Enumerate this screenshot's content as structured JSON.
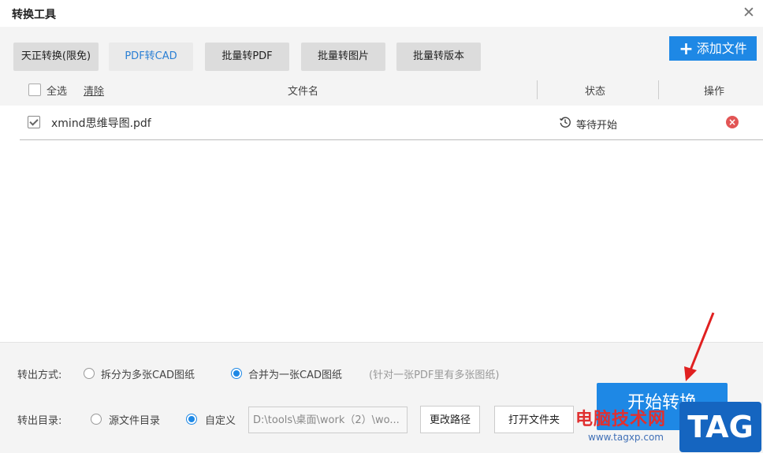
{
  "window": {
    "title": "转换工具"
  },
  "tabs": [
    {
      "label": "天正转换(限免)",
      "active": false
    },
    {
      "label": "PDF转CAD",
      "active": true
    },
    {
      "label": "批量转PDF",
      "active": false
    },
    {
      "label": "批量转图片",
      "active": false
    },
    {
      "label": "批量转版本",
      "active": false
    }
  ],
  "toolbar": {
    "add_file_label": "添加文件"
  },
  "table": {
    "select_all_label": "全选",
    "clear_label": "清除",
    "col_filename": "文件名",
    "col_status": "状态",
    "col_action": "操作",
    "rows": [
      {
        "filename": "xmind思维导图.pdf",
        "status": "等待开始",
        "checked": true
      }
    ]
  },
  "output": {
    "mode_label": "转出方式:",
    "mode_options": [
      "拆分为多张CAD图纸",
      "合并为一张CAD图纸"
    ],
    "mode_selected": 1,
    "mode_note": "(针对一张PDF里有多张图纸)",
    "dir_label": "转出目录:",
    "dir_options": [
      "源文件目录",
      "自定义"
    ],
    "dir_selected": 1,
    "path_value": "D:\\tools\\桌面\\work（2）\\wo...",
    "change_path_label": "更改路径",
    "open_folder_label": "打开文件夹",
    "start_label": "开始转换"
  },
  "watermark": {
    "site_name": "电脑技术网",
    "url": "www.tagxp.com",
    "tag": "TAG"
  },
  "colors": {
    "accent": "#1e88e5",
    "active_tab_text": "#2a7fd4",
    "delete": "#e25555",
    "panel_bg": "#f4f4f4"
  }
}
